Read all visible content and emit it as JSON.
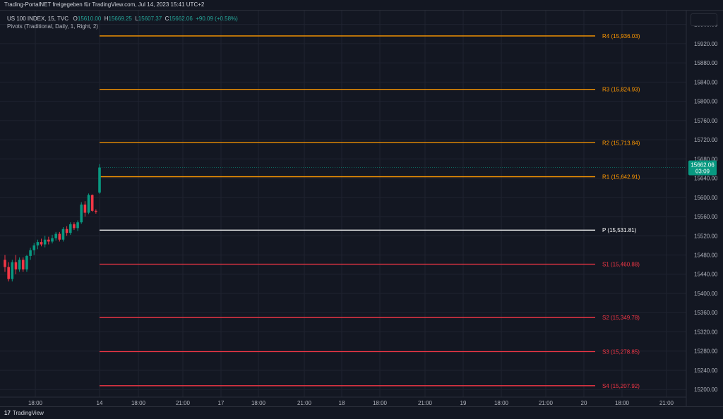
{
  "header": {
    "attribution": "Trading-PortalNET freigegeben für TradingView.com, Jul 14, 2023 15:41 UTC+2"
  },
  "legend": {
    "symbol": "US 100 INDEX, 15, TVC",
    "open_label": "O",
    "open_value": "15610.00",
    "high_label": "H",
    "high_value": "15669.25",
    "low_label": "L",
    "low_value": "15607.37",
    "close_label": "C",
    "close_value": "15662.06",
    "change": "+90.09 (+0.58%)",
    "study": "Pivots (Traditional, Daily, 1, Right, 2)"
  },
  "price_tag": {
    "price": "15662.06",
    "countdown": "03:09",
    "color": "#089981"
  },
  "footer": {
    "logo": "17",
    "brand": "TradingView"
  },
  "chart_data": {
    "type": "candlestick",
    "y_axis_ticks": [
      15200,
      15240,
      15280,
      15320,
      15360,
      15400,
      15440,
      15480,
      15520,
      15560,
      15600,
      15640,
      15680,
      15720,
      15760,
      15800,
      15840,
      15880,
      15920,
      15960
    ],
    "y_axis_range": [
      15190,
      15980
    ],
    "x_axis_ticks": [
      "18:00",
      "14",
      "18:00",
      "21:00",
      "17",
      "18:00",
      "21:00",
      "18",
      "18:00",
      "21:00",
      "19",
      "18:00",
      "21:00",
      "20",
      "18:00",
      "21:00"
    ],
    "grid": true,
    "pivots": [
      {
        "label": "R4 (15,936.03)",
        "value": 15936.03,
        "color": "#ff9800"
      },
      {
        "label": "R3 (15,824.93)",
        "value": 15824.93,
        "color": "#ff9800"
      },
      {
        "label": "R2 (15,713.84)",
        "value": 15713.84,
        "color": "#ff9800"
      },
      {
        "label": "R1 (15,642.91)",
        "value": 15642.91,
        "color": "#ff9800"
      },
      {
        "label": "P (15,531.81)",
        "value": 15531.81,
        "color": "#ffffff"
      },
      {
        "label": "S1 (15,460.88)",
        "value": 15460.88,
        "color": "#f23645"
      },
      {
        "label": "S2 (15,349.78)",
        "value": 15349.78,
        "color": "#f23645"
      },
      {
        "label": "S3 (15,278.85)",
        "value": 15278.85,
        "color": "#f23645"
      },
      {
        "label": "S4 (15,207.92)",
        "value": 15207.92,
        "color": "#f23645"
      }
    ],
    "candles": [
      {
        "o": 15470,
        "h": 15480,
        "l": 15445,
        "c": 15455
      },
      {
        "o": 15455,
        "h": 15465,
        "l": 15425,
        "c": 15430
      },
      {
        "o": 15430,
        "h": 15470,
        "l": 15425,
        "c": 15465
      },
      {
        "o": 15465,
        "h": 15480,
        "l": 15440,
        "c": 15450
      },
      {
        "o": 15450,
        "h": 15475,
        "l": 15445,
        "c": 15470
      },
      {
        "o": 15470,
        "h": 15475,
        "l": 15445,
        "c": 15450
      },
      {
        "o": 15450,
        "h": 15480,
        "l": 15445,
        "c": 15478
      },
      {
        "o": 15478,
        "h": 15495,
        "l": 15470,
        "c": 15490
      },
      {
        "o": 15490,
        "h": 15505,
        "l": 15480,
        "c": 15500
      },
      {
        "o": 15500,
        "h": 15512,
        "l": 15492,
        "c": 15507
      },
      {
        "o": 15507,
        "h": 15514,
        "l": 15498,
        "c": 15502
      },
      {
        "o": 15502,
        "h": 15520,
        "l": 15496,
        "c": 15512
      },
      {
        "o": 15512,
        "h": 15518,
        "l": 15502,
        "c": 15508
      },
      {
        "o": 15508,
        "h": 15522,
        "l": 15504,
        "c": 15515
      },
      {
        "o": 15515,
        "h": 15528,
        "l": 15510,
        "c": 15524
      },
      {
        "o": 15524,
        "h": 15528,
        "l": 15508,
        "c": 15512
      },
      {
        "o": 15512,
        "h": 15538,
        "l": 15508,
        "c": 15534
      },
      {
        "o": 15534,
        "h": 15540,
        "l": 15520,
        "c": 15526
      },
      {
        "o": 15526,
        "h": 15548,
        "l": 15522,
        "c": 15544
      },
      {
        "o": 15544,
        "h": 15548,
        "l": 15532,
        "c": 15536
      },
      {
        "o": 15536,
        "h": 15552,
        "l": 15530,
        "c": 15548
      },
      {
        "o": 15548,
        "h": 15590,
        "l": 15545,
        "c": 15585
      },
      {
        "o": 15585,
        "h": 15592,
        "l": 15560,
        "c": 15568
      },
      {
        "o": 15568,
        "h": 15608,
        "l": 15565,
        "c": 15605
      },
      {
        "o": 15605,
        "h": 15606,
        "l": 15570,
        "c": 15572
      },
      {
        "o": 15572,
        "h": 15575,
        "l": 15566,
        "c": 15570
      },
      {
        "o": 15610.0,
        "h": 15669.25,
        "l": 15607.37,
        "c": 15662.06
      }
    ]
  }
}
